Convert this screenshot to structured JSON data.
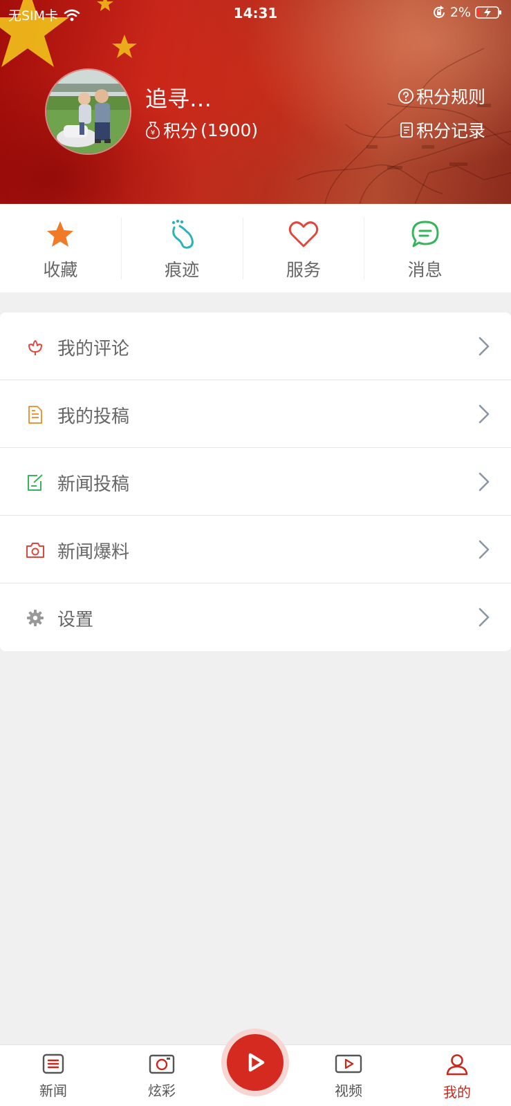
{
  "status_bar": {
    "carrier": "无SIM卡",
    "time": "14:31",
    "battery": "2%"
  },
  "profile": {
    "name": "追寻…",
    "points_label": "积分",
    "points_value": "(1900)",
    "rules_label": "积分规则",
    "record_label": "积分记录"
  },
  "quick_actions": [
    {
      "label": "收藏",
      "icon": "star-icon",
      "color": "#f07a26"
    },
    {
      "label": "痕迹",
      "icon": "footprint-icon",
      "color": "#2bb3b8"
    },
    {
      "label": "服务",
      "icon": "heart-icon",
      "color": "#e0473c"
    },
    {
      "label": "消息",
      "icon": "chat-icon",
      "color": "#35b55a"
    }
  ],
  "menu": [
    {
      "label": "我的评论",
      "icon": "flower-icon",
      "color": "#e0473c"
    },
    {
      "label": "我的投稿",
      "icon": "document-icon",
      "color": "#f0963a"
    },
    {
      "label": "新闻投稿",
      "icon": "edit-icon",
      "color": "#35b55a"
    },
    {
      "label": "新闻爆料",
      "icon": "camera-icon",
      "color": "#e0473c"
    },
    {
      "label": "设置",
      "icon": "gear-icon",
      "color": "#999999"
    }
  ],
  "tabs": [
    {
      "label": "新闻",
      "icon": "news-icon"
    },
    {
      "label": "炫彩",
      "icon": "camera-tab-icon"
    },
    {
      "label": "视频",
      "icon": "video-icon"
    },
    {
      "label": "我的",
      "icon": "person-icon",
      "active": true
    }
  ],
  "colors": {
    "accent": "#d42a1f",
    "active_tab": "#c9271d",
    "background": "#f0f0f0"
  }
}
